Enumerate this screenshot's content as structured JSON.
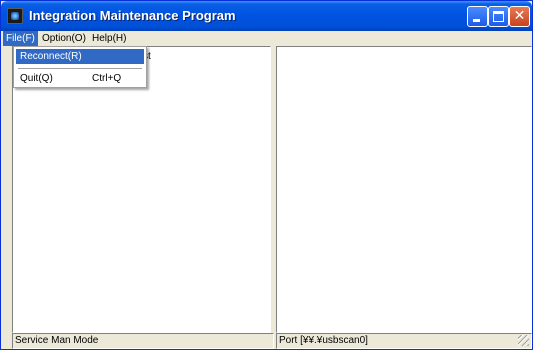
{
  "window": {
    "title": "Integration Maintenance Program"
  },
  "menu": [
    {
      "label": "File(F)"
    },
    {
      "label": "Option(O)"
    },
    {
      "label": "Help(H)"
    }
  ],
  "file_menu": {
    "items": [
      {
        "label": "Reconnect(R)",
        "shortcut": ""
      },
      {
        "label": "Quit(Q)",
        "shortcut": "Ctrl+Q"
      }
    ]
  },
  "left_pane": {
    "partial_text": "st"
  },
  "status": {
    "left": "Service Man Mode",
    "right": "Port [¥¥.¥usbscan0]"
  }
}
